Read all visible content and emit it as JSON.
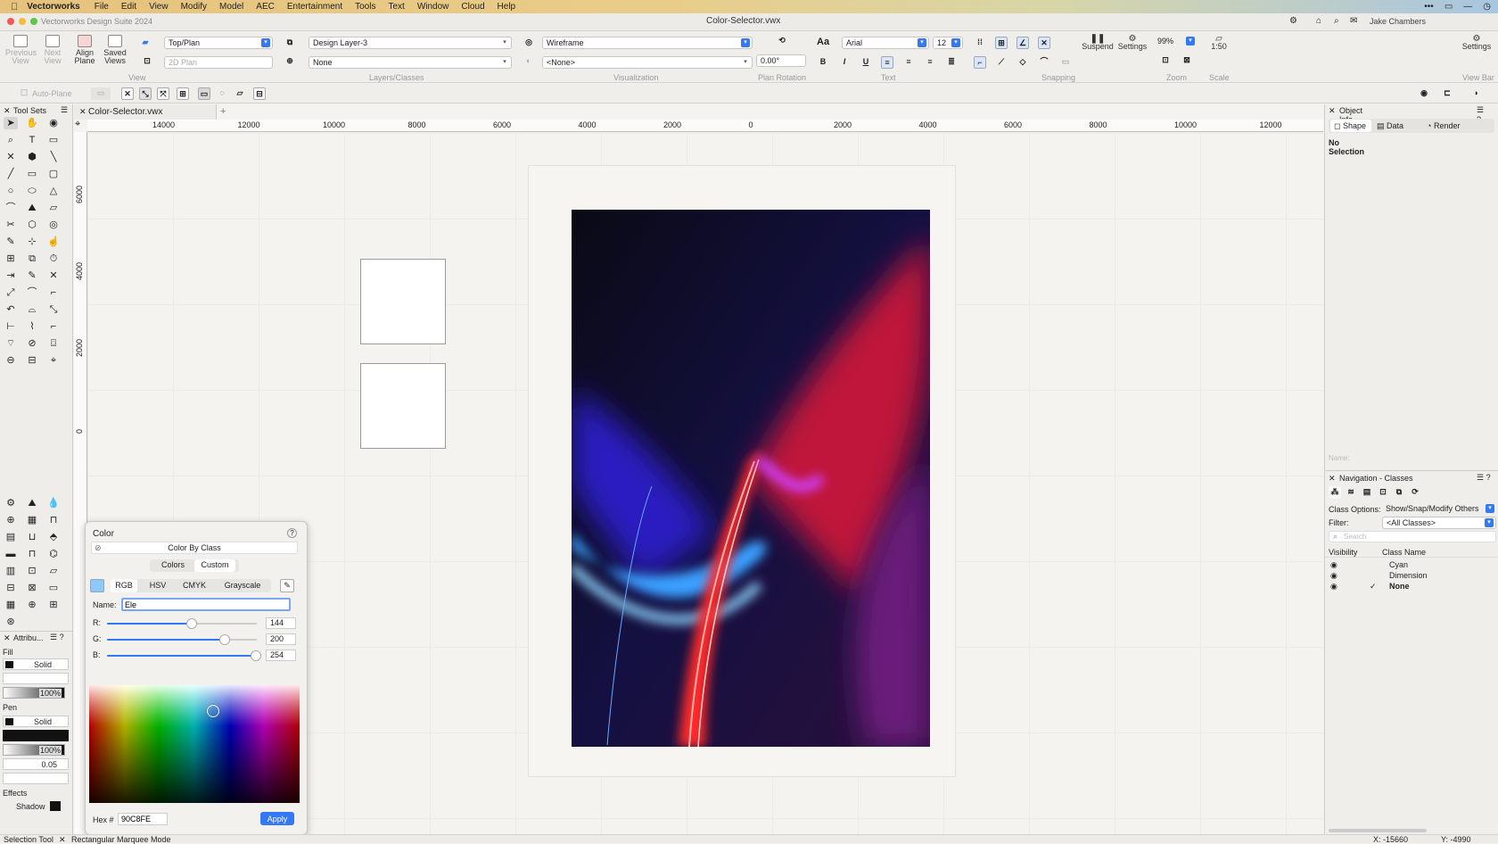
{
  "menubar": {
    "app": "Vectorworks",
    "items": [
      "File",
      "Edit",
      "View",
      "Modify",
      "Model",
      "AEC",
      "Entertainment",
      "Tools",
      "Text",
      "Window",
      "Cloud",
      "Help"
    ]
  },
  "window": {
    "app_title": "Vectorworks Design Suite 2024",
    "doc_title": "Color-Selector.vwx",
    "user": "Jake Chambers"
  },
  "toolbar": {
    "previous_view": "Previous View",
    "next_view": "Next View",
    "align_plane": "Align Plane",
    "saved_views": "Saved Views",
    "view_select": "Top/Plan",
    "plan_select": "2D Plan",
    "layer_select": "Design Layer-3",
    "class_select": "None",
    "render_select": "Wireframe",
    "lighting_select": "<None>",
    "rotation": "0.00°",
    "font": "Arial",
    "font_size": "12",
    "suspend": "Suspend",
    "settings": "Settings",
    "zoom": "99%",
    "scale": "1:50",
    "settings_right": "Settings",
    "groups": {
      "view": "View",
      "layers": "Layers/Classes",
      "visualization": "Visualization",
      "plan_rotation": "Plan Rotation",
      "text": "Text",
      "snapping": "Snapping",
      "zoom": "Zoom",
      "scale": "Scale",
      "view_bar": "View Bar"
    }
  },
  "modebar": {
    "auto_plane": "Auto-Plane"
  },
  "tool_sets": {
    "title": "Tool Sets"
  },
  "doc_tab": "Color-Selector.vwx",
  "ruler": {
    "top": [
      "14000",
      "12000",
      "10000",
      "8000",
      "6000",
      "4000",
      "2000",
      "0",
      "2000",
      "4000",
      "6000",
      "8000",
      "10000",
      "12000"
    ],
    "left": [
      "6000",
      "4000",
      "2000",
      "0"
    ]
  },
  "attributes": {
    "title": "Attribu...",
    "fill_label": "Fill",
    "fill_style": "Solid",
    "fill_opacity": "100%",
    "pen_label": "Pen",
    "pen_style": "Solid",
    "pen_opacity": "100%",
    "line_weight": "0.05",
    "effects_label": "Effects",
    "shadow_label": "Shadow"
  },
  "color_popup": {
    "title": "Color",
    "help": "?",
    "by_class": "Color By Class",
    "tab_colors": "Colors",
    "tab_custom": "Custom",
    "modes": [
      "RGB",
      "HSV",
      "CMYK",
      "Grayscale"
    ],
    "name_label": "Name:",
    "name_value": "Ele",
    "r_label": "R:",
    "r_value": "144",
    "g_label": "G:",
    "g_value": "200",
    "b_label": "B:",
    "b_value": "254",
    "r": 144,
    "g": 200,
    "b": 254,
    "hex_label": "Hex #",
    "hex_value": "90C8FE",
    "apply": "Apply",
    "swatch_color": "#90C8FE"
  },
  "object_info": {
    "title": "Object Info - Shape",
    "tabs": [
      "Shape",
      "Data",
      "Render"
    ],
    "selection": "No Selection",
    "name_placeholder": "Name:"
  },
  "navigation": {
    "title": "Navigation - Classes",
    "class_options_label": "Class Options:",
    "class_options_value": "Show/Snap/Modify Others",
    "filter_label": "Filter:",
    "filter_value": "<All Classes>",
    "search_placeholder": "Search",
    "col_visibility": "Visibility",
    "col_class_name": "Class Name",
    "classes": [
      {
        "name": "Cyan",
        "active": false
      },
      {
        "name": "Dimension",
        "active": false
      },
      {
        "name": "None",
        "active": true
      }
    ]
  },
  "status": {
    "tool": "Selection Tool",
    "mode": "Rectangular Marquee Mode",
    "x": "X: -15660",
    "y": "Y: -4990"
  }
}
